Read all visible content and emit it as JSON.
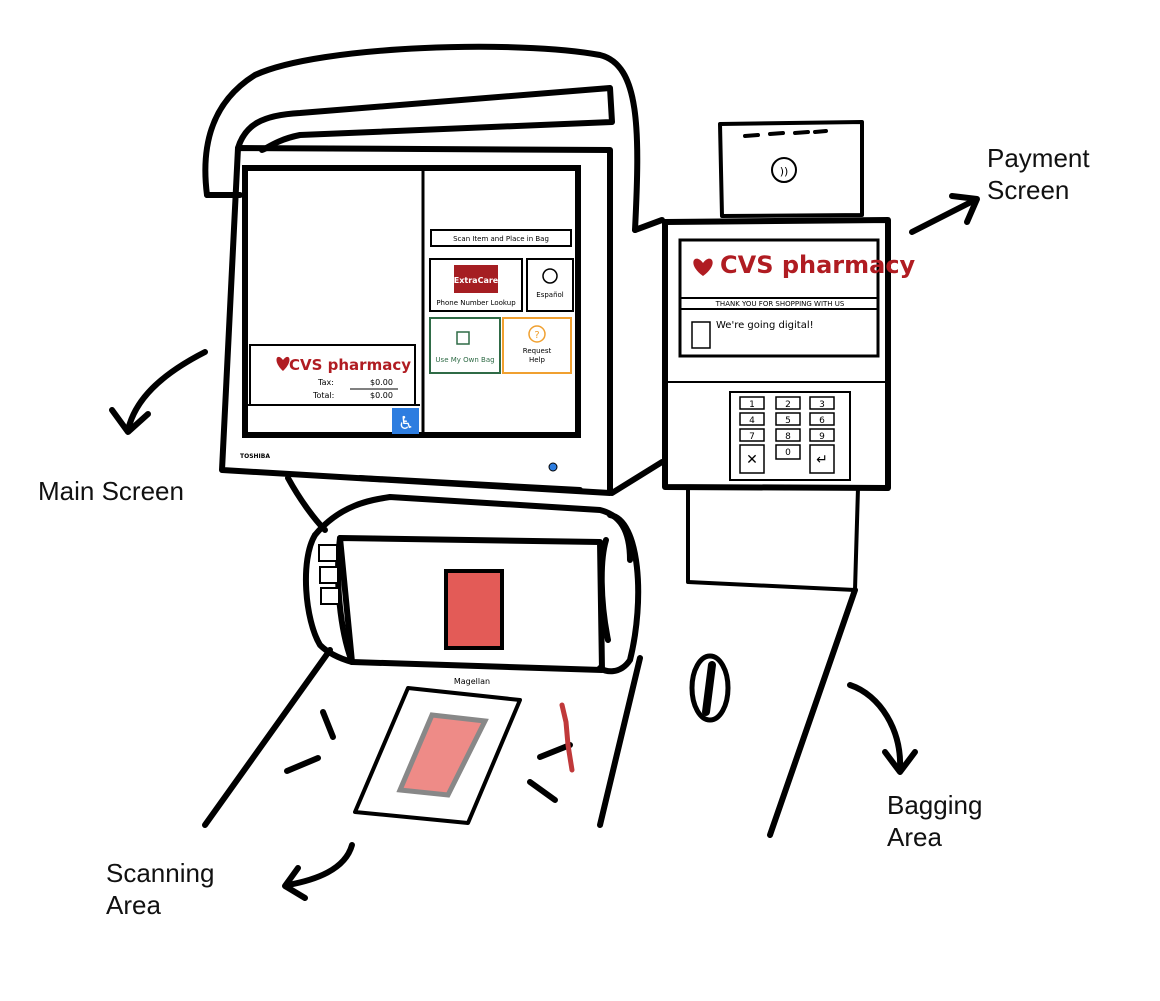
{
  "annotations": {
    "main_screen": "Main Screen",
    "payment_screen": "Payment\nScreen",
    "scanning_area": "Scanning\nArea",
    "bagging_area": "Bagging\nArea"
  },
  "main_screen": {
    "brand_logo": "CVS pharmacy",
    "tax_label": "Tax:",
    "tax_value": "$0.00",
    "total_label": "Total:",
    "total_value": "$0.00",
    "maker": "TOSHIBA",
    "instruction": "Scan Item and Place in Bag",
    "extracare_label": "ExtraCare",
    "phone_lookup": "Phone Number Lookup",
    "espanol": "Español",
    "own_bag": "Use My Own Bag",
    "request_help_line1": "Request",
    "request_help_line2": "Help"
  },
  "scanner": {
    "brand": "Magellan"
  },
  "payment_screen": {
    "brand_logo": "CVS pharmacy",
    "thank_you": "THANK YOU FOR SHOPPING WITH US",
    "digital_note": "We're going digital!",
    "keypad_keys": [
      "1",
      "2",
      "3",
      "4",
      "5",
      "6",
      "7",
      "8",
      "9",
      "✕",
      "0",
      "↵"
    ]
  },
  "colors": {
    "cvs_red": "#b01c22",
    "extracare_red": "#a51e22",
    "own_bag_green": "#2f6b46",
    "help_orange": "#f0a030",
    "accessibility_blue": "#2d7de0",
    "scanner_window": "#e35b57",
    "scan_bed": "#ee8b87"
  }
}
